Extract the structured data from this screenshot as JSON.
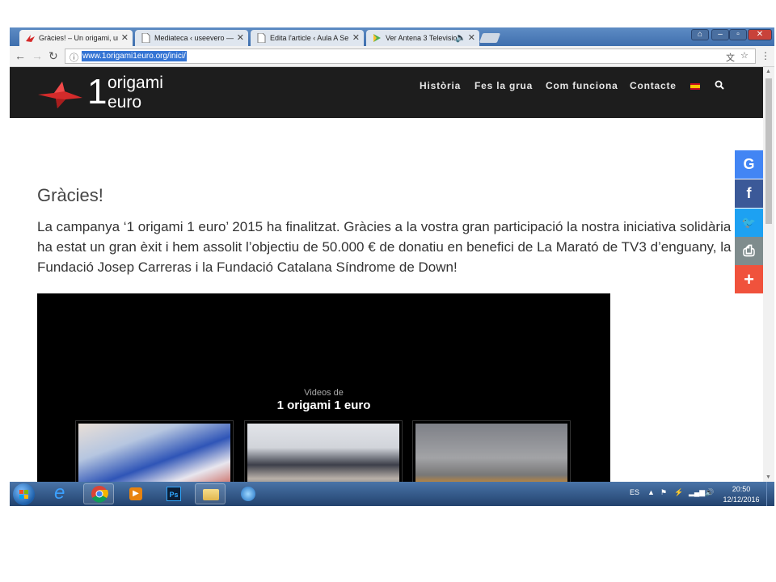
{
  "browser": {
    "tabs": [
      {
        "label": "Gràcies! – Un origami, un",
        "active": true
      },
      {
        "label": "Mediateca ‹ useevero —",
        "active": false
      },
      {
        "label": "Edita l'article ‹ Aula A Se",
        "active": false
      },
      {
        "label": "Ver Antena 3 Televisio",
        "active": false
      }
    ],
    "url": "www.1origami1euro.org/inici/"
  },
  "site": {
    "logo": {
      "number": "1",
      "line1": "origami",
      "line2": "euro"
    },
    "nav": [
      "Història",
      "Fes la grua",
      "Com funciona",
      "Contacte"
    ]
  },
  "content": {
    "title": "Gràcies!",
    "intro": "La campanya ‘1 origami 1 euro’ 2015 ha finalitzat. Gràcies a la vostra gran participació la nostra iniciativa solidària ha estat un gran èxit i hem assolit l’objectiu de 50.000 € de donatiu en benefici de La Marató de TV3 d’enguany, la Fundació Josep Carreras i la Fundació Catalana Síndrome de Down!",
    "video": {
      "subtitle": "Videos de",
      "title": "1 origami 1 euro"
    }
  },
  "share": [
    {
      "name": "google",
      "glyph": "G",
      "color": "#4285f4"
    },
    {
      "name": "facebook",
      "glyph": "f",
      "color": "#3b5998"
    },
    {
      "name": "twitter",
      "glyph": "🐦",
      "color": "#1da1f2"
    },
    {
      "name": "print",
      "glyph": "⎙",
      "color": "#7f8c8d"
    },
    {
      "name": "more",
      "glyph": "+",
      "color": "#f0523c"
    }
  ],
  "taskbar": {
    "language": "ES",
    "time": "20:50",
    "date": "12/12/2016"
  }
}
